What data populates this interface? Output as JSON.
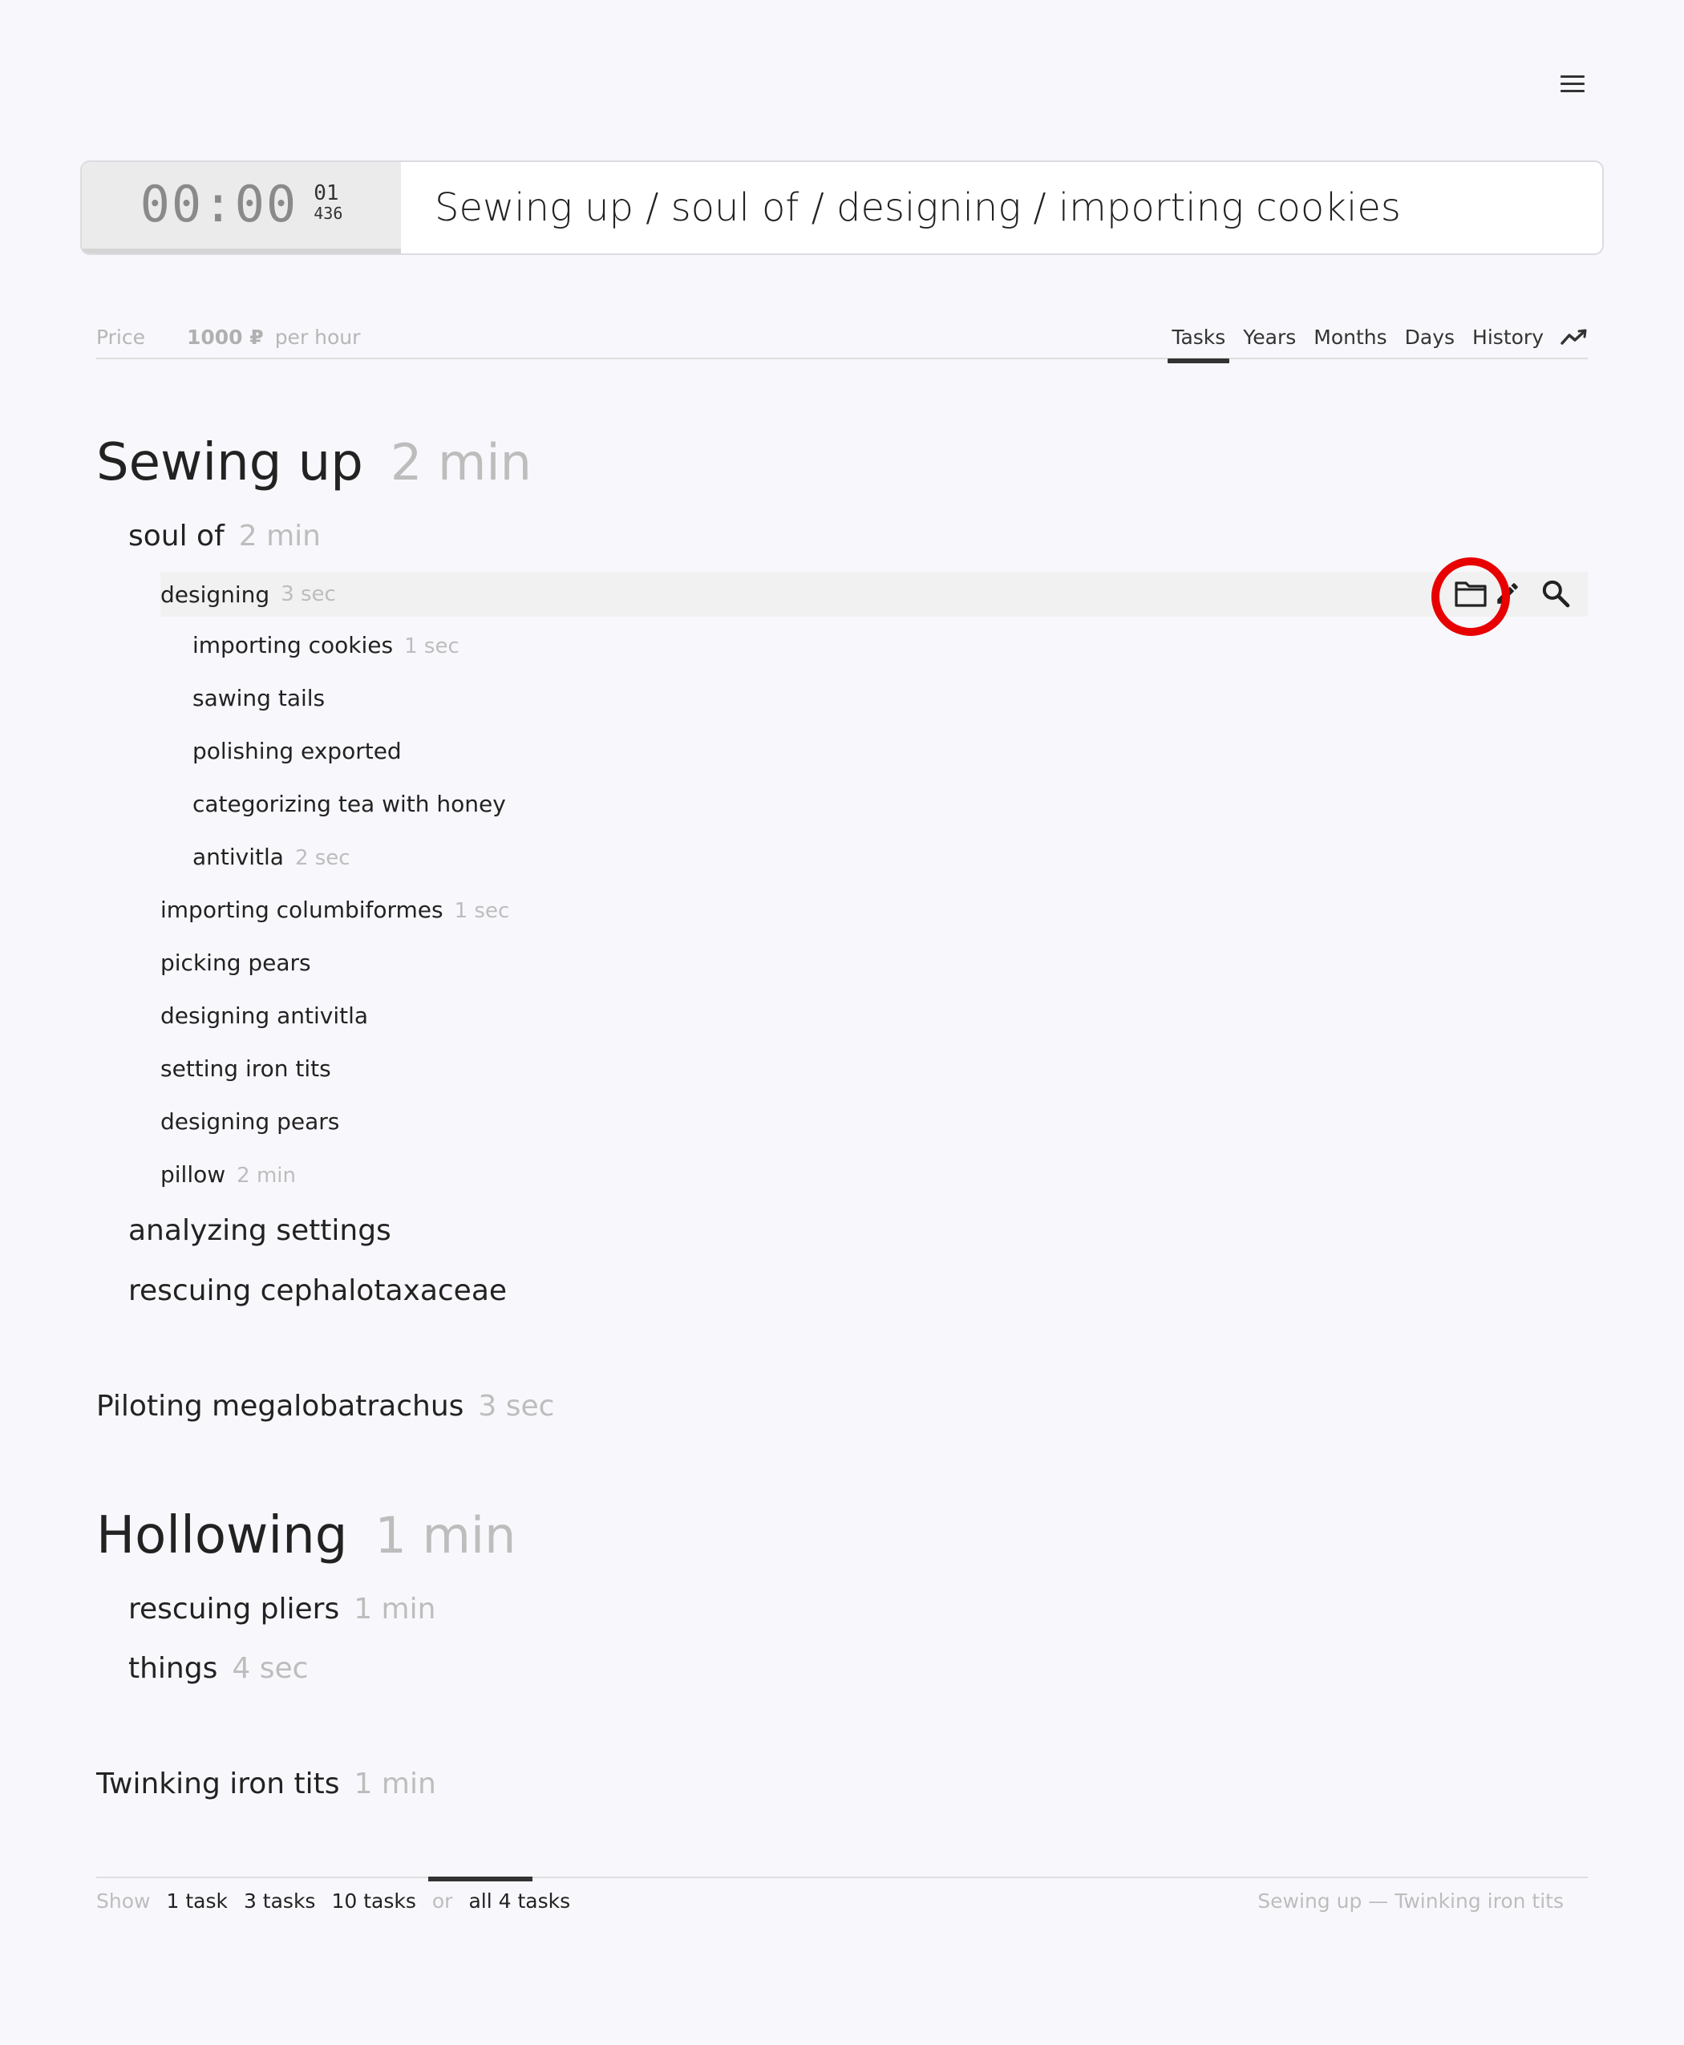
{
  "header": {
    "menu_icon": "hamburger-menu-icon",
    "timer": {
      "display": "00:00",
      "small_top": "01",
      "small_bottom": "436"
    },
    "current_task_path": "Sewing up / soul of / designing / importing cookies"
  },
  "toolbar": {
    "price_label": "Price",
    "price_value": "1000 ₽",
    "price_unit": "per hour",
    "tabs": [
      {
        "label": "Tasks",
        "active": true
      },
      {
        "label": "Years"
      },
      {
        "label": "Months"
      },
      {
        "label": "Days"
      },
      {
        "label": "History"
      }
    ],
    "trend_icon": "trend-chart-icon"
  },
  "tree": [
    {
      "name": "Sewing up",
      "duration": "2 min"
    },
    {
      "name": "soul of",
      "duration": "2 min"
    },
    {
      "name": "designing",
      "duration": "3 sec"
    },
    {
      "name": "importing cookies",
      "duration": "1 sec"
    },
    {
      "name": "sawing tails",
      "duration": ""
    },
    {
      "name": "polishing exported",
      "duration": ""
    },
    {
      "name": "categorizing tea with honey",
      "duration": ""
    },
    {
      "name": "antivitla",
      "duration": "2 sec"
    },
    {
      "name": "importing columbiformes",
      "duration": "1 sec"
    },
    {
      "name": "picking pears",
      "duration": ""
    },
    {
      "name": "designing antivitla",
      "duration": ""
    },
    {
      "name": "setting iron tits",
      "duration": ""
    },
    {
      "name": "designing pears",
      "duration": ""
    },
    {
      "name": "pillow",
      "duration": "2 min"
    },
    {
      "name": "analyzing settings",
      "duration": ""
    },
    {
      "name": "rescuing cephalotaxaceae",
      "duration": ""
    },
    {
      "name": "Piloting megalobatrachus",
      "duration": "3 sec"
    },
    {
      "name": "Hollowing",
      "duration": "1 min"
    },
    {
      "name": "rescuing pliers",
      "duration": "1 min"
    },
    {
      "name": "things",
      "duration": "4 sec"
    },
    {
      "name": "Twinking iron tits",
      "duration": "1 min"
    }
  ],
  "row_actions": {
    "folder": "folder-icon",
    "edit": "pencil-icon",
    "search": "search-icon"
  },
  "footer": {
    "show_label": "Show",
    "options": [
      "1 task",
      "3 tasks",
      "10 tasks"
    ],
    "or_label": "or",
    "all_option": "all 4 tasks",
    "range": "Sewing up — Twinking iron tits"
  },
  "colors": {
    "highlight_ring": "#e80000",
    "muted_text": "#bdbdbd",
    "text": "#222222"
  }
}
